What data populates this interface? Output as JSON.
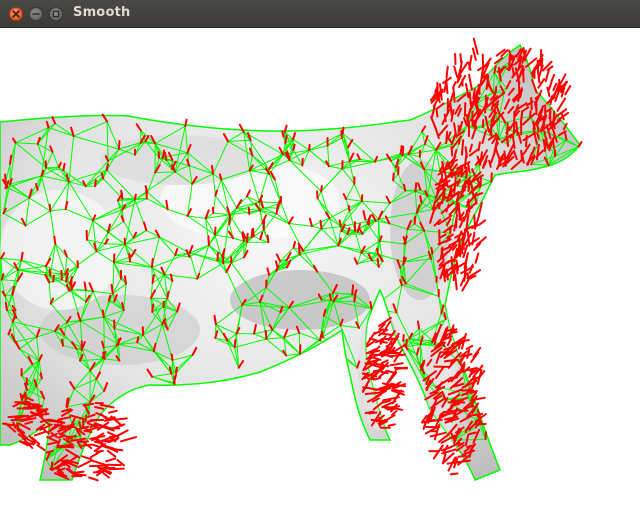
{
  "window": {
    "title": "Smooth",
    "buttons": [
      "close-icon",
      "minimize-icon",
      "maximize-icon"
    ]
  },
  "viewport": {
    "content": "smoothed-mesh-render",
    "colors": {
      "background": "#ffffff",
      "wireframe": "#00ff00",
      "normals": "#ff0000",
      "surface_light": "#f4f4f4",
      "surface_shade": "#bdbdbd",
      "titlebar": "#3c3b37",
      "close_button": "#e95420"
    }
  }
}
